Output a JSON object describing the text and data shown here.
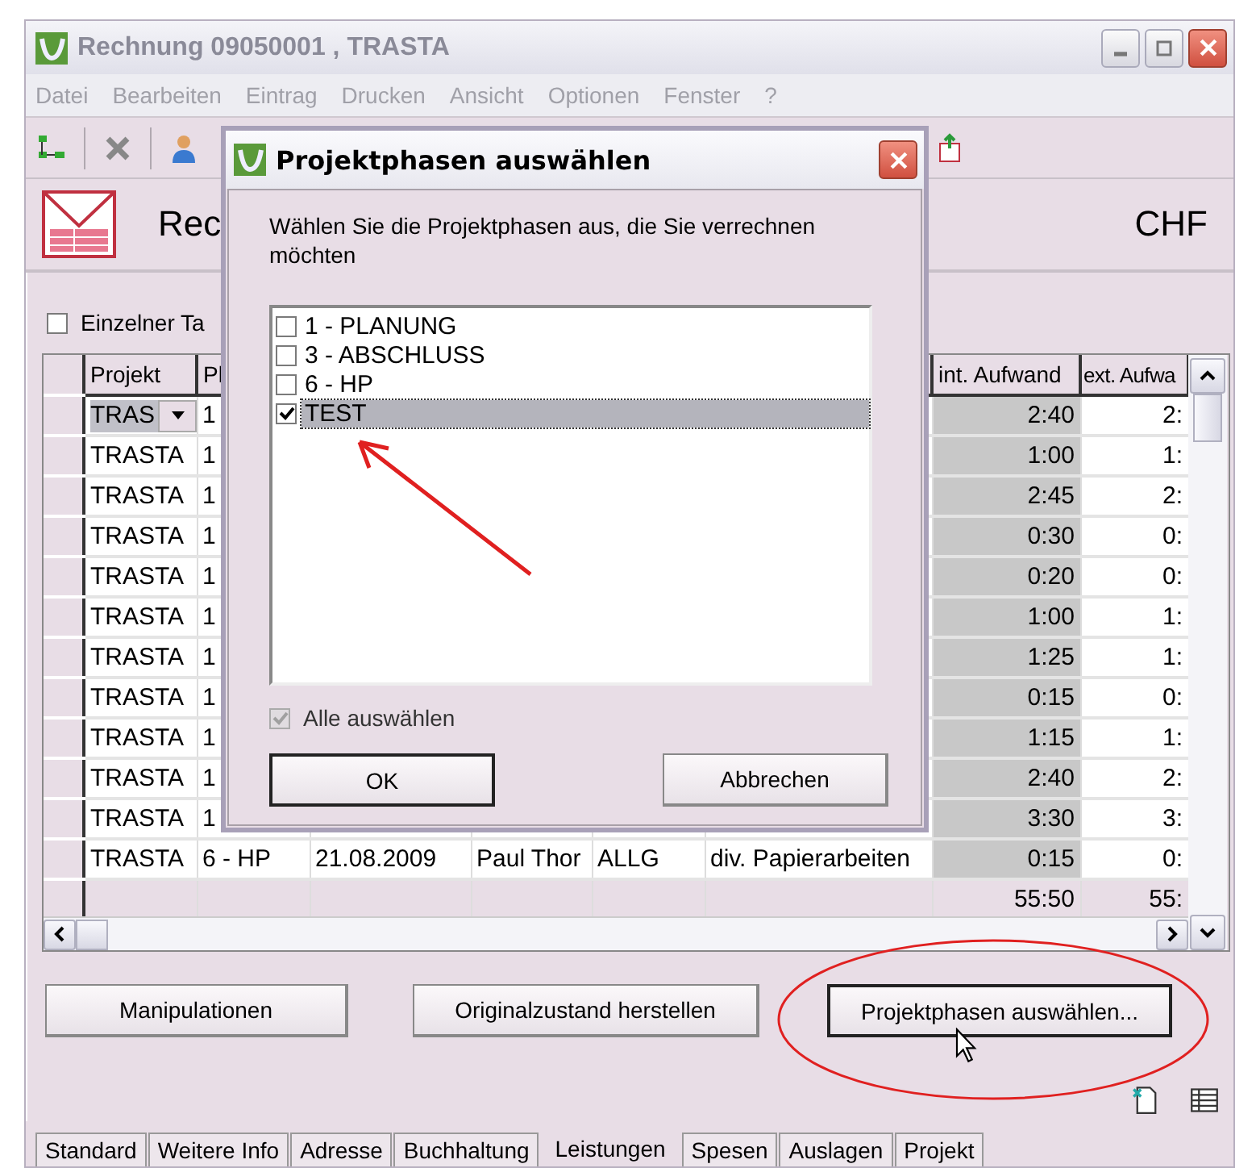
{
  "window": {
    "title": "Rechnung 09050001 , TRASTA"
  },
  "menu": [
    "Datei",
    "Bearbeiten",
    "Eintrag",
    "Drucken",
    "Ansicht",
    "Optionen",
    "Fenster",
    "?"
  ],
  "header": {
    "title": "Rec",
    "currency": "CHF"
  },
  "single_day": {
    "label": "Einzelner Ta",
    "checked": false
  },
  "table": {
    "columns": [
      "Projekt",
      "Pl",
      "",
      "",
      "",
      "",
      "int. Aufwand",
      "ext. Aufwa"
    ],
    "rows": [
      {
        "kind": "dropdown",
        "project": "TRAS",
        "phase": "1",
        "int": "2:40",
        "ext": "2:"
      },
      {
        "project": "TRASTA",
        "phase": "1",
        "int": "1:00",
        "ext": "1:"
      },
      {
        "project": "TRASTA",
        "phase": "1",
        "int": "2:45",
        "ext": "2:"
      },
      {
        "project": "TRASTA",
        "phase": "1",
        "int": "0:30",
        "ext": "0:"
      },
      {
        "project": "TRASTA",
        "phase": "1",
        "int": "0:20",
        "ext": "0:"
      },
      {
        "project": "TRASTA",
        "phase": "1",
        "int": "1:00",
        "ext": "1:"
      },
      {
        "project": "TRASTA",
        "phase": "1",
        "int": "1:25",
        "ext": "1:"
      },
      {
        "project": "TRASTA",
        "phase": "1",
        "int": "0:15",
        "ext": "0:"
      },
      {
        "project": "TRASTA",
        "phase": "1",
        "int": "1:15",
        "ext": "1:"
      },
      {
        "project": "TRASTA",
        "phase": "1",
        "int": "2:40",
        "ext": "2:"
      },
      {
        "project": "TRASTA",
        "phase": "1",
        "int": "3:30",
        "ext": "3:"
      },
      {
        "project": "TRASTA",
        "phase": "6 - HP",
        "date": "21.08.2009",
        "person": "Paul Thor",
        "code": "ALLG",
        "description": "div. Papierarbeiten",
        "int": "0:15",
        "ext": "0:"
      }
    ],
    "total": {
      "int": "55:50",
      "ext": "55:"
    }
  },
  "buttons": [
    "Manipulationen",
    "Originalzustand herstellen",
    "Projektphasen auswählen..."
  ],
  "tabs": [
    {
      "label": "Standard",
      "selected": false
    },
    {
      "label": "Weitere Info",
      "selected": false
    },
    {
      "label": "Adresse",
      "selected": false
    },
    {
      "label": "Buchhaltung",
      "selected": false
    },
    {
      "label": "Leistungen",
      "selected": true
    },
    {
      "label": "Spesen",
      "selected": false
    },
    {
      "label": "Auslagen",
      "selected": false
    },
    {
      "label": "Projekt",
      "selected": false
    }
  ],
  "dialog": {
    "title": "Projektphasen auswählen",
    "prompt": "Wählen Sie die Projektphasen aus, die Sie verrechnen möchten",
    "phases": [
      {
        "label": "1 - PLANUNG",
        "checked": false,
        "selected": false
      },
      {
        "label": "3 - ABSCHLUSS",
        "checked": false,
        "selected": false
      },
      {
        "label": "6 - HP",
        "checked": false,
        "selected": false
      },
      {
        "label": "TEST",
        "checked": true,
        "selected": true
      }
    ],
    "select_all": {
      "label": "Alle auswählen",
      "checked": true,
      "disabled": true
    },
    "ok": "OK",
    "cancel": "Abbrechen"
  }
}
